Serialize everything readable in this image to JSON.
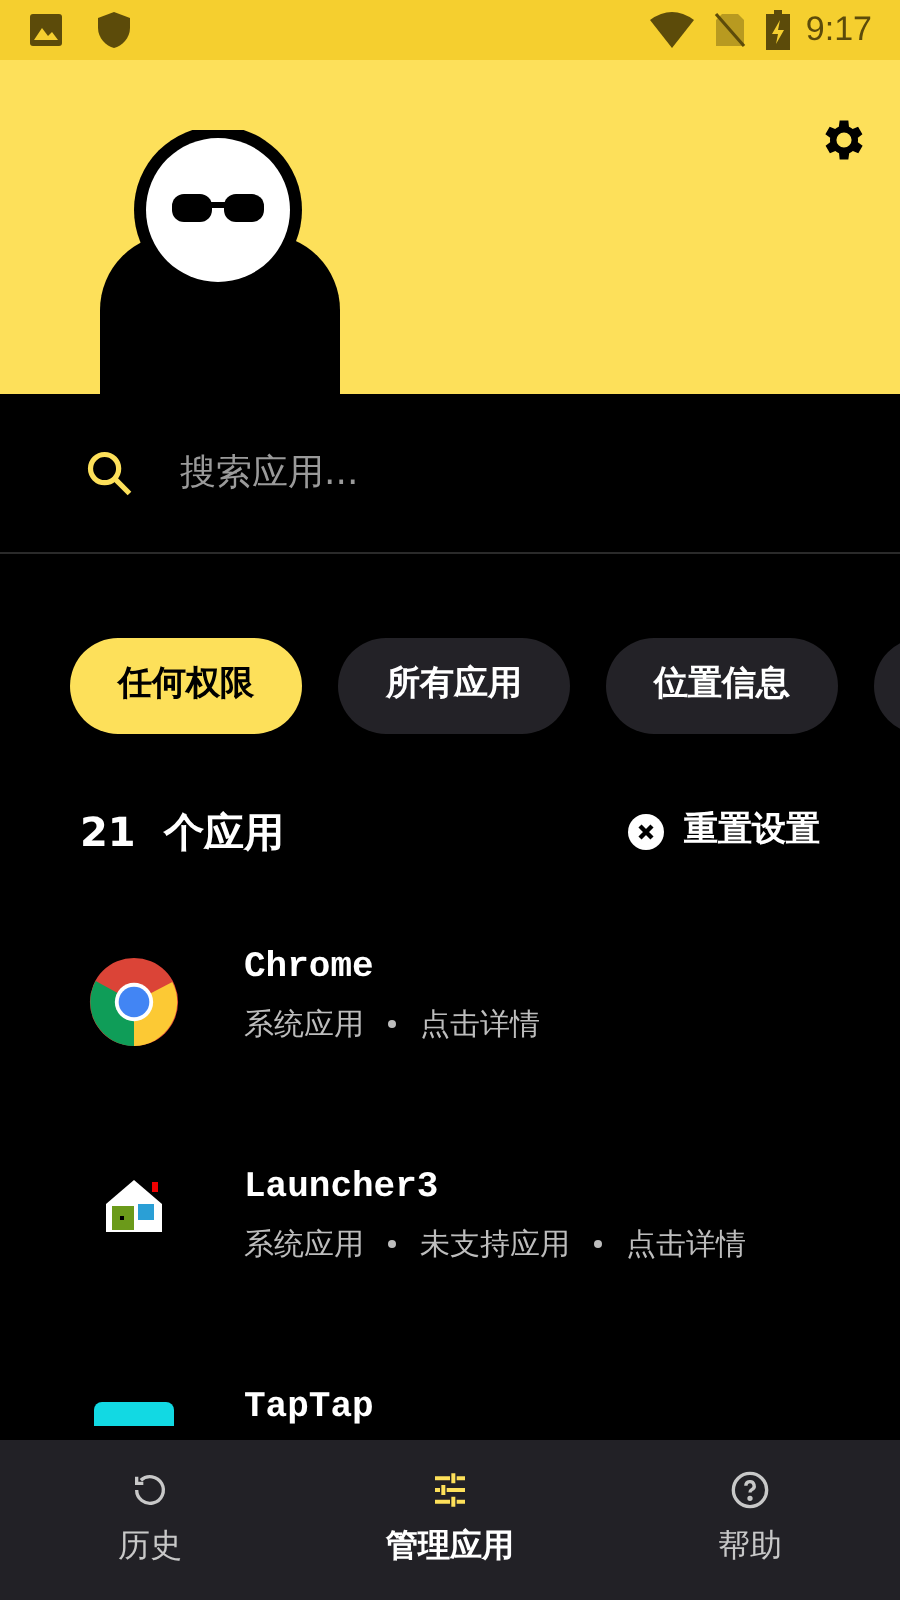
{
  "status_bar": {
    "time": "9:17"
  },
  "search": {
    "placeholder": "搜索应用..."
  },
  "filters": [
    {
      "label": "任何权限",
      "selected": true
    },
    {
      "label": "所有应用",
      "selected": false
    },
    {
      "label": "位置信息",
      "selected": false
    }
  ],
  "summary": {
    "count": "21",
    "unit": "个应用",
    "reset": "重置设置"
  },
  "apps": [
    {
      "kind": "chrome",
      "name": "Chrome",
      "tags": [
        "系统应用",
        "点击详情"
      ]
    },
    {
      "kind": "launcher",
      "name": "Launcher3",
      "tags": [
        "系统应用",
        "未支持应用",
        "点击详情"
      ]
    },
    {
      "kind": "tile",
      "name": "TapTap"
    }
  ],
  "nav": [
    {
      "kind": "history",
      "label": "历史",
      "selected": false
    },
    {
      "kind": "sliders",
      "label": "管理应用",
      "selected": true
    },
    {
      "kind": "help",
      "label": "帮助",
      "selected": false
    }
  ]
}
